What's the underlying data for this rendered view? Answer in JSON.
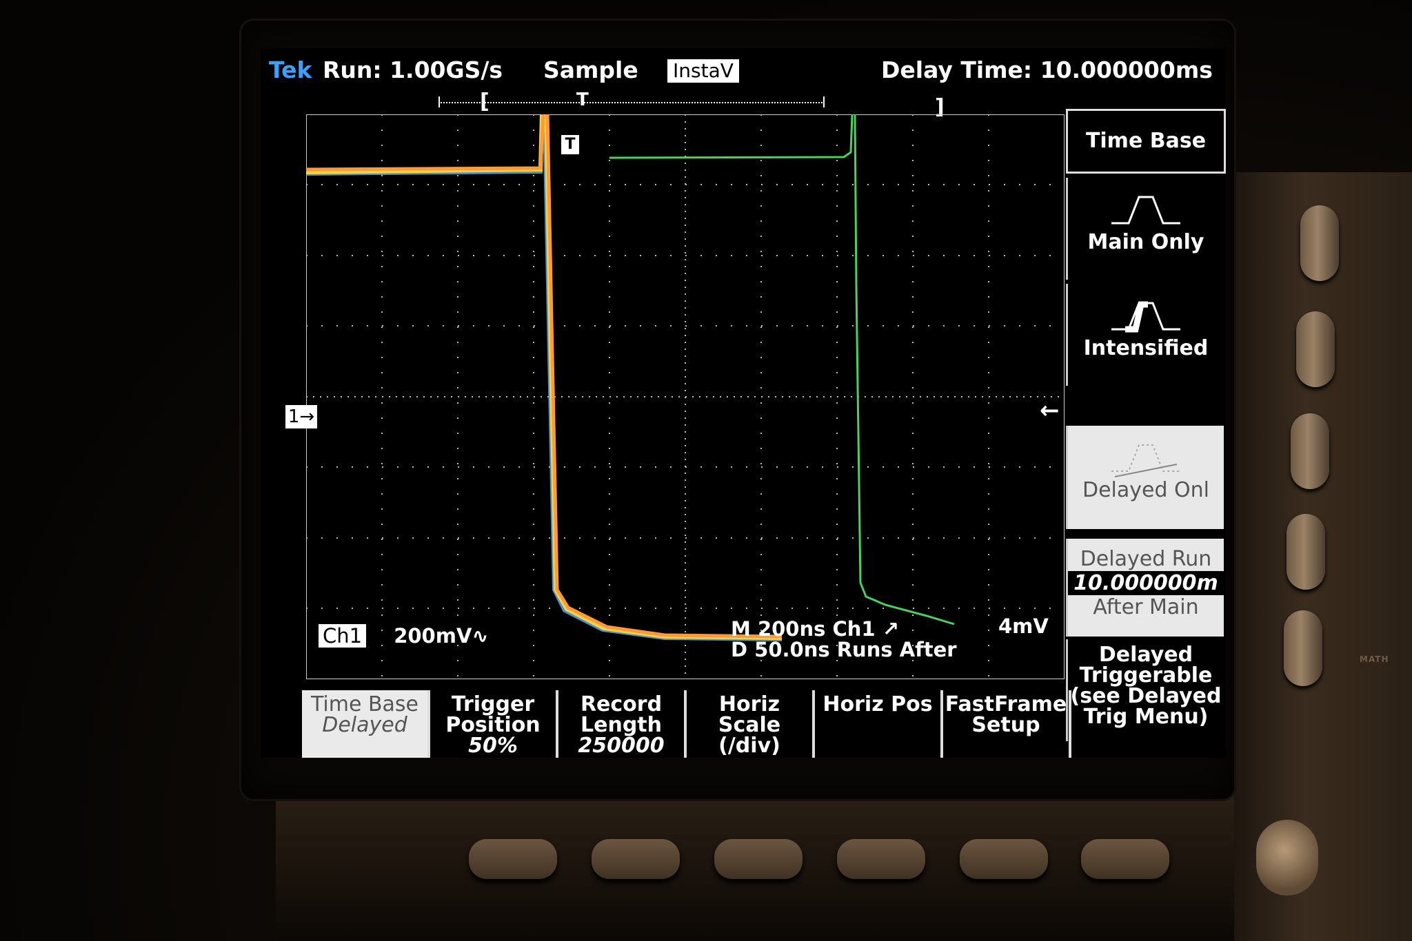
{
  "status_bar": {
    "brand": "Tek",
    "run_state": "Run: 1.00GS/s",
    "acquisition_mode": "Sample",
    "instavu_badge": "InstaV",
    "delay_time": "Delay Time: 10.000000ms",
    "record_trigger_marker": "T",
    "record_bracket_left": "[",
    "record_bracket_right": "]"
  },
  "display": {
    "channel_marker": "1→",
    "trigger_marker": "T",
    "trigger_level_arrow": "←",
    "ch1_badge": "Ch1",
    "ch1_scale": "200mV∿",
    "main_timebase": "M  200ns  Ch1 ↗",
    "trigger_level": "4mV",
    "delayed_timebase": "D  50.0ns  Runs After"
  },
  "side_menu": {
    "title": "Time Base",
    "items": [
      {
        "label": "Main Only",
        "icon": "pulse-shape-icon"
      },
      {
        "label": "Intensified",
        "icon": "intensified-pulse-icon"
      },
      {
        "label": "Delayed Onl",
        "icon": "delayed-pulse-icon",
        "selected": true
      },
      {
        "label_top": "Delayed Run",
        "value": "10.000000m",
        "label_bottom": "After Main"
      },
      {
        "lines": [
          "Delayed",
          "Triggerable",
          "(see Delayed",
          "Trig Menu)"
        ]
      }
    ]
  },
  "bottom_menu": [
    {
      "label": "Time Base",
      "value": "Delayed",
      "selected": true
    },
    {
      "label": "Trigger Position",
      "value": "50%"
    },
    {
      "label": "Record Length",
      "value": "250000"
    },
    {
      "label": "Horiz Scale (/div)",
      "value": ""
    },
    {
      "label": "Horiz Pos",
      "value": ""
    },
    {
      "label": "FastFrame Setup",
      "value": ""
    }
  ],
  "colors": {
    "brand": "#3da0ff",
    "trace_orange": "#ff9a3c",
    "trace_yellow": "#ffd23c",
    "trace_blue": "#5ab4ff",
    "trace_green": "#49d35a"
  }
}
